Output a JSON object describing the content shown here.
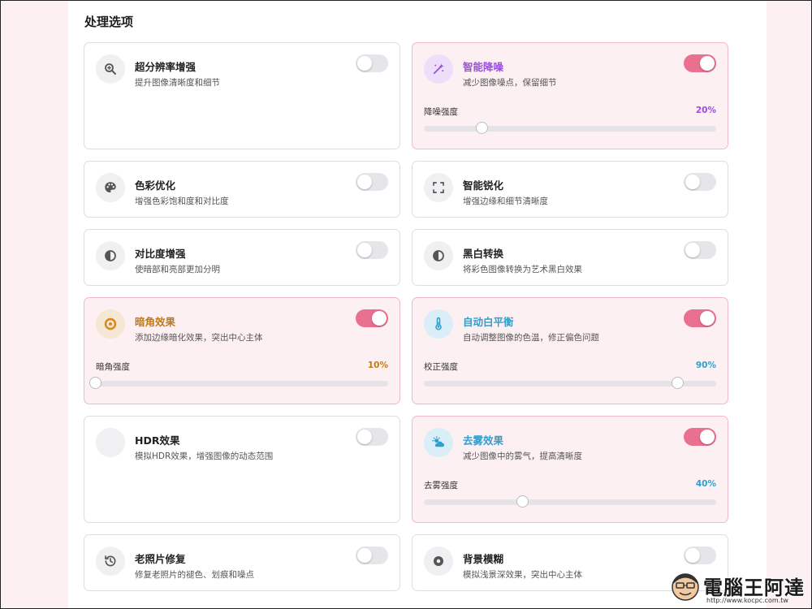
{
  "section": {
    "title": "处理选项"
  },
  "cards": [
    {
      "id": "super-resolution",
      "title": "超分辨率增强",
      "desc": "提升图像清晰度和细节",
      "enabled": false,
      "icon": "zoom-in-icon",
      "accent": "#555555"
    },
    {
      "id": "denoise",
      "title": "智能降噪",
      "desc": "减少图像噪点，保留细节",
      "enabled": true,
      "icon": "magic-wand-icon",
      "accent": "#9b4dde",
      "slider": {
        "label": "降噪强度",
        "value_text": "20%",
        "value": 0.2
      }
    },
    {
      "id": "color-optimize",
      "title": "色彩优化",
      "desc": "增强色彩饱和度和对比度",
      "enabled": false,
      "icon": "palette-icon",
      "accent": "#555555"
    },
    {
      "id": "sharpen",
      "title": "智能锐化",
      "desc": "增强边缘和细节清晰度",
      "enabled": false,
      "icon": "focus-frame-icon",
      "accent": "#555555"
    },
    {
      "id": "contrast",
      "title": "对比度增强",
      "desc": "使暗部和亮部更加分明",
      "enabled": false,
      "icon": "contrast-icon",
      "accent": "#555555"
    },
    {
      "id": "monochrome",
      "title": "黑白转换",
      "desc": "将彩色图像转换为艺术黑白效果",
      "enabled": false,
      "icon": "contrast-icon",
      "accent": "#555555"
    },
    {
      "id": "vignette",
      "title": "暗角效果",
      "desc": "添加边缘暗化效果，突出中心主体",
      "enabled": true,
      "icon": "vignette-icon",
      "accent": "#c47a12",
      "slider": {
        "label": "暗角强度",
        "value_text": "10%",
        "value": 0.0
      }
    },
    {
      "id": "white-balance",
      "title": "自动白平衡",
      "desc": "自动调整图像的色温，修正偏色问题",
      "enabled": true,
      "icon": "thermometer-icon",
      "accent": "#2e9fcf",
      "slider": {
        "label": "校正强度",
        "value_text": "90%",
        "value": 0.87
      }
    },
    {
      "id": "hdr",
      "title": "HDR效果",
      "desc": "模拟HDR效果，增强图像的动态范围",
      "enabled": false,
      "icon": "hdr-icon",
      "accent": "#555555"
    },
    {
      "id": "dehaze",
      "title": "去雾效果",
      "desc": "减少图像中的雾气，提高清晰度",
      "enabled": true,
      "icon": "weather-icon",
      "accent": "#2e9fcf",
      "slider": {
        "label": "去雾强度",
        "value_text": "40%",
        "value": 0.34
      }
    },
    {
      "id": "photo-restore",
      "title": "老照片修复",
      "desc": "修复老照片的褪色、划痕和噪点",
      "enabled": false,
      "icon": "history-icon",
      "accent": "#555555"
    },
    {
      "id": "background-blur",
      "title": "背景模糊",
      "desc": "模拟浅景深效果，突出中心主体",
      "enabled": false,
      "icon": "aperture-icon",
      "accent": "#555555"
    }
  ],
  "watermark": {
    "text": "電腦王阿達",
    "url": "http://www.kocpc.com.tw"
  },
  "colors": {
    "toggle_on": "#e9708e",
    "toggle_off": "#e6e6ea",
    "active_bg": "#fdf0f3"
  }
}
